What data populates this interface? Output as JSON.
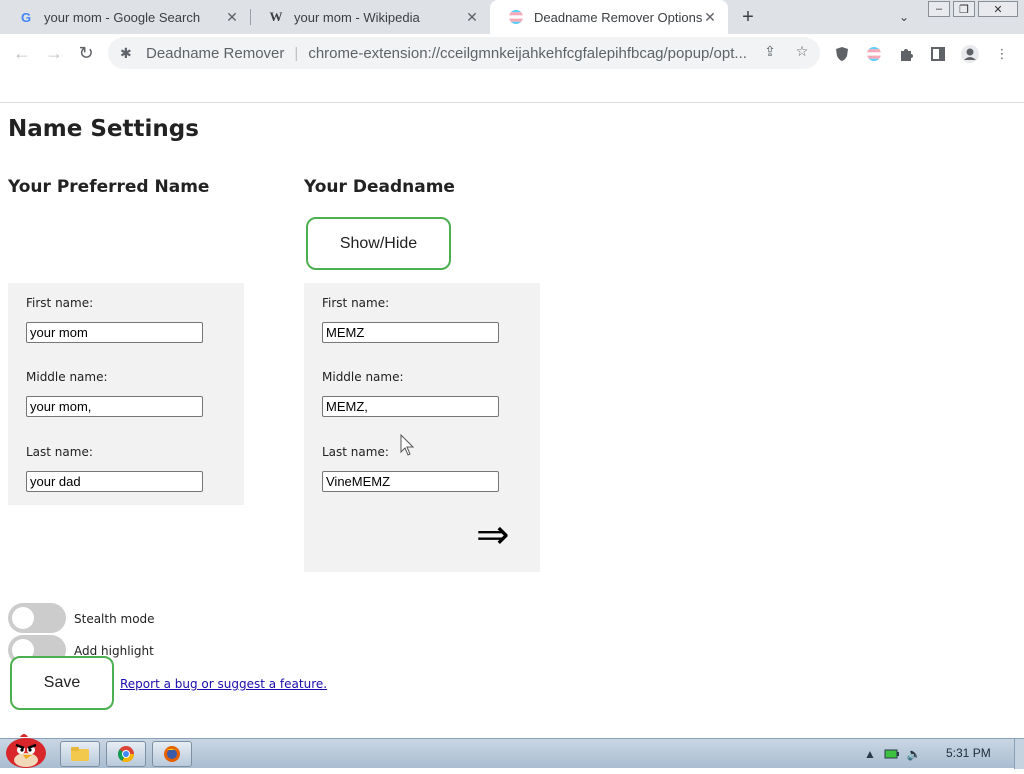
{
  "tabs": [
    {
      "title": "your mom - Google Search",
      "favicon": "google-icon",
      "active": false
    },
    {
      "title": "your mom - Wikipedia",
      "favicon": "wikipedia-icon",
      "active": false
    },
    {
      "title": "Deadname Remover Options",
      "favicon": "trans-flag-icon",
      "active": true
    }
  ],
  "toolbar": {
    "site_name": "Deadname Remover",
    "url": "chrome-extension://cceilgmnkeijahkehfcgfalepihfbcag/popup/opt..."
  },
  "page": {
    "title": "Name Settings",
    "preferred_heading": "Your Preferred Name",
    "deadname_heading": "Your Deadname",
    "show_hide_label": "Show/Hide",
    "arrow": "⇒",
    "preferred": {
      "first_label": "First name:",
      "first_value": "your mom",
      "middle_label": "Middle name:",
      "middle_value": "your mom,",
      "last_label": "Last name:",
      "last_value": "your dad"
    },
    "deadname": {
      "first_label": "First name:",
      "first_value": "MEMZ",
      "middle_label": "Middle name:",
      "middle_value": "MEMZ,",
      "last_label": "Last name:",
      "last_value": "VineMEMZ"
    },
    "stealth_label": "Stealth mode",
    "highlight_label": "Add highlight",
    "save_label": "Save",
    "report_link": "Report a bug or suggest a feature."
  },
  "taskbar": {
    "clock": "5:31 PM"
  },
  "colors": {
    "accent_green": "#4caf50",
    "panel_bg": "#f2f2f2",
    "link": "#1a0dab"
  }
}
